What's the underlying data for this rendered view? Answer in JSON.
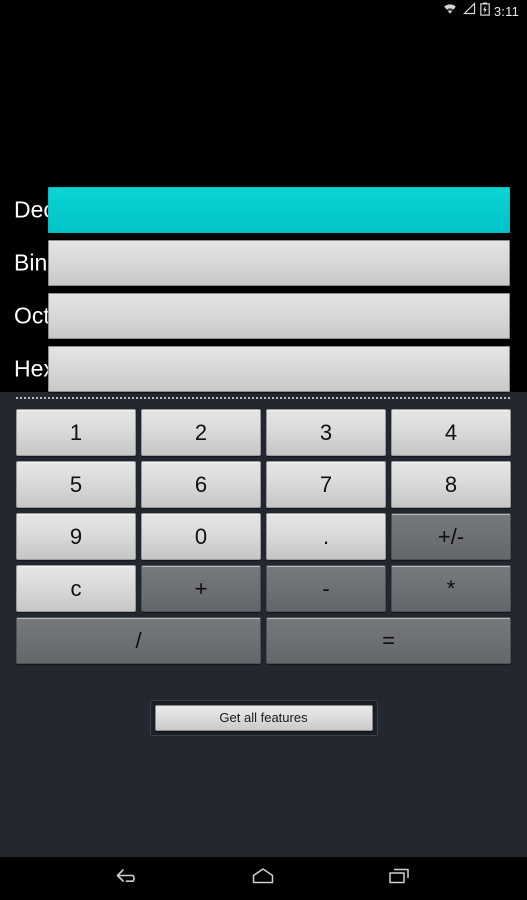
{
  "status_bar": {
    "time": "3:11",
    "icons": [
      "wifi-icon",
      "signal-icon",
      "battery-charging-icon"
    ]
  },
  "converter": {
    "fields": [
      {
        "label": "Dec",
        "value": "",
        "placeholder": "",
        "active": true,
        "name": "decimal"
      },
      {
        "label": "Bin",
        "value": "",
        "placeholder": "",
        "active": false,
        "name": "binary"
      },
      {
        "label": "Oct",
        "value": "",
        "placeholder": "",
        "active": false,
        "name": "octal"
      },
      {
        "label": "Hex",
        "value": "",
        "placeholder": "",
        "active": false,
        "name": "hexadecimal"
      }
    ]
  },
  "keypad": {
    "rows": [
      [
        {
          "label": "1",
          "type": "digit"
        },
        {
          "label": "2",
          "type": "digit"
        },
        {
          "label": "3",
          "type": "digit"
        },
        {
          "label": "4",
          "type": "digit"
        }
      ],
      [
        {
          "label": "5",
          "type": "digit"
        },
        {
          "label": "6",
          "type": "digit"
        },
        {
          "label": "7",
          "type": "digit"
        },
        {
          "label": "8",
          "type": "digit"
        }
      ],
      [
        {
          "label": "9",
          "type": "digit"
        },
        {
          "label": "0",
          "type": "digit"
        },
        {
          "label": ".",
          "type": "digit"
        },
        {
          "label": "+/-",
          "type": "op"
        }
      ],
      [
        {
          "label": "c",
          "type": "digit"
        },
        {
          "label": "+",
          "type": "op"
        },
        {
          "label": "-",
          "type": "op"
        },
        {
          "label": "*",
          "type": "op"
        }
      ],
      [
        {
          "label": "/",
          "type": "op",
          "wide": true
        },
        {
          "label": "=",
          "type": "op",
          "wide": true
        }
      ]
    ]
  },
  "features": {
    "button_label": "Get all features"
  },
  "nav_bar": {
    "buttons": [
      {
        "name": "back-icon",
        "label": "Back"
      },
      {
        "name": "home-icon",
        "label": "Home"
      },
      {
        "name": "recents-icon",
        "label": "Recent apps"
      }
    ]
  },
  "colors": {
    "accent_cyan": "#05cbcd",
    "panel_bg": "#232830",
    "black_bg": "#000000",
    "key_light": "#dcdcdc",
    "key_dark": "#6e7175",
    "label_text": "#ffffff"
  }
}
